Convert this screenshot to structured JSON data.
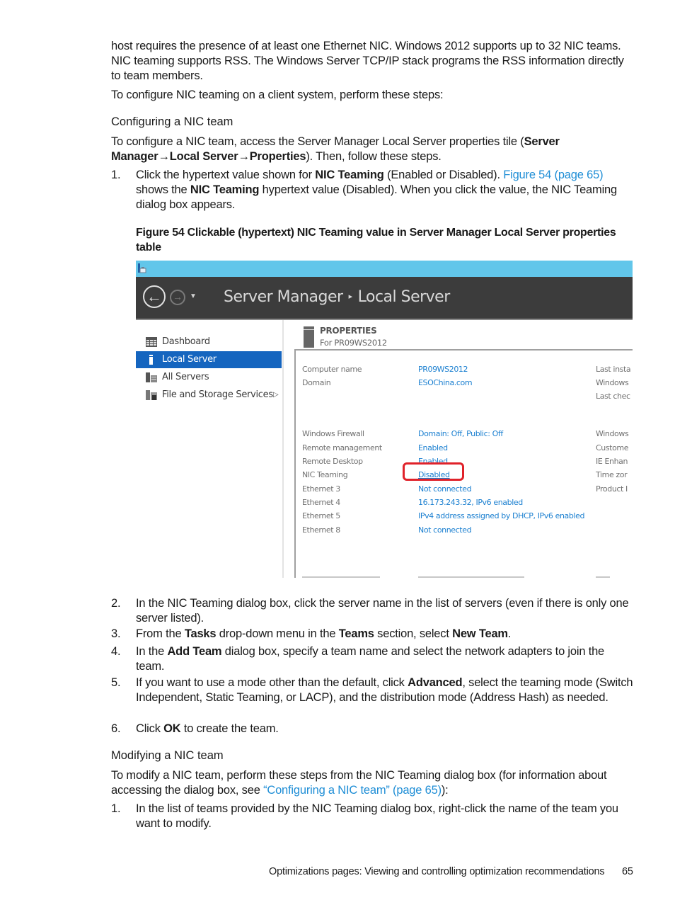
{
  "intro": {
    "paragraph": "host requires the presence of at least one Ethernet NIC. Windows 2012 supports up to 32 NIC teams. NIC teaming supports RSS. The Windows Server TCP/IP stack programs the RSS information directly to team members.",
    "lead": "To configure NIC teaming on a client system, perform these steps:"
  },
  "configure_section": {
    "heading": "Configuring a NIC team",
    "para_prefix": "To configure a NIC team, access the Server Manager Local Server properties tile (",
    "path_server_manager": "Server Manager",
    "arrow": "→",
    "path_local_server": "Local Server",
    "path_properties": "Properties",
    "para_suffix": "). Then, follow these steps.",
    "step1": {
      "num": "1.",
      "t1": "Click the hypertext value shown for ",
      "b1": "NIC Teaming",
      "t2": " (Enabled or Disabled). ",
      "link": "Figure 54 (page 65)",
      "t3": " shows the ",
      "b2": "NIC Teaming",
      "t4": " hypertext value (Disabled). When you click the value, the NIC Teaming dialog box appears."
    },
    "figure_caption": "Figure 54 Clickable (hypertext) NIC Teaming value in Server Manager Local Server properties table",
    "steps": [
      {
        "num": "2.",
        "t1": "In the NIC Teaming dialog box, click the server name in the list of servers (even if there is only one server listed).",
        "b1": "",
        "t2": "",
        "b2": "",
        "t3": "",
        "b3": "",
        "t4": ""
      },
      {
        "num": "3.",
        "t1": "From the ",
        "b1": "Tasks",
        "t2": " drop-down menu in the ",
        "b2": "Teams",
        "t3": " section, select ",
        "b3": "New Team",
        "t4": "."
      },
      {
        "num": "4.",
        "t1": "In the ",
        "b1": "Add Team",
        "t2": " dialog box, specify a team name and select the network adapters to join the team.",
        "b2": "",
        "t3": "",
        "b3": "",
        "t4": ""
      },
      {
        "num": "5.",
        "t1": "If you want to use a mode other than the default, click ",
        "b1": "Advanced",
        "t2": ", select the teaming mode (Switch Independent, Static Teaming, or LACP), and the distribution mode (Address Hash) as needed.",
        "b2": "",
        "t3": "",
        "b3": "",
        "t4": ""
      },
      {
        "num": "6.",
        "t1": "Click ",
        "b1": "OK",
        "t2": " to create the team.",
        "b2": "",
        "t3": "",
        "b3": "",
        "t4": ""
      }
    ]
  },
  "modify_section": {
    "heading": "Modifying a NIC team",
    "para_prefix": "To modify a NIC team, perform these steps from the NIC Teaming dialog box (for information about accessing the dialog box, see ",
    "link": "“Configuring a NIC team” (page 65)",
    "para_suffix": "):",
    "step1": {
      "num": "1.",
      "text": "In the list of teams provided by the NIC Teaming dialog box, right-click the name of the team you want to modify."
    }
  },
  "screenshot": {
    "breadcrumb_root": "Server Manager",
    "breadcrumb_sep": "▸",
    "breadcrumb_current": "Local Server",
    "back_glyph": "←",
    "forward_glyph": "→",
    "dropdown_glyph": "▼",
    "sidebar": [
      {
        "label": "Dashboard",
        "icon": "dashboard-icon",
        "active": false
      },
      {
        "label": "Local Server",
        "icon": "server-icon",
        "active": true
      },
      {
        "label": "All Servers",
        "icon": "servers-icon",
        "active": false
      },
      {
        "label": "File and Storage Services",
        "icon": "storage-icon",
        "active": false,
        "expand": "▷"
      }
    ],
    "properties_title": "PROPERTIES",
    "properties_subtitle": "For PR09WS2012",
    "rows": [
      {
        "key": "Computer name",
        "value": "PR09WS2012",
        "right": "Last insta"
      },
      {
        "key": "Domain",
        "value": "ESOChina.com",
        "right": "Windows"
      },
      {
        "key": "",
        "value": "",
        "right": "Last chec"
      },
      {
        "key": "Windows Firewall",
        "value": "Domain: Off, Public: Off",
        "right": "Windows"
      },
      {
        "key": "Remote management",
        "value": "Enabled",
        "right": "Custome"
      },
      {
        "key": "Remote Desktop",
        "value": "Enabled",
        "right": "IE Enhan"
      },
      {
        "key": "NIC Teaming",
        "value": "Disabled",
        "right": "Time zor"
      },
      {
        "key": "Ethernet 3",
        "value": "Not connected",
        "right": "Product I"
      },
      {
        "key": "Ethernet 4",
        "value": "16.173.243.32, IPv6 enabled",
        "right": ""
      },
      {
        "key": "Ethernet 5",
        "value": "IPv4 address assigned by DHCP, IPv6 enabled",
        "right": ""
      },
      {
        "key": "Ethernet 8",
        "value": "Not connected",
        "right": ""
      }
    ]
  },
  "footer": {
    "section_title": "Optimizations pages: Viewing and controlling optimization recommendations",
    "page_number": "65"
  }
}
